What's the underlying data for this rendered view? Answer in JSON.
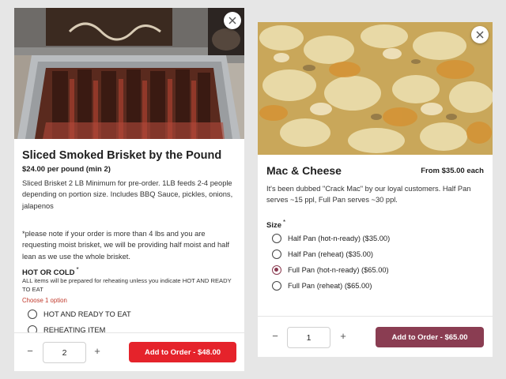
{
  "colors": {
    "add_red": "#e5232b",
    "add_maroon": "#8a3d52",
    "choose_red": "#c0392b"
  },
  "brisket": {
    "title": "Sliced Smoked Brisket by the Pound",
    "price": "$24.00 per pound  (min 2)",
    "description": "Sliced Brisket 2 LB Minimum for pre-order. 1LB feeds 2-4 people depending on portion size. Includes BBQ Sauce, pickles, onions, jalapenos",
    "note": "*please note if your order is more than 4 lbs and you are requesting moist brisket, we will be providing half moist and half lean as we use the whole brisket.",
    "option_group": {
      "title": "HOT OR COLD",
      "required_mark": "*",
      "subtitle": "ALL items will be prepared for reheating unless you indicate HOT AND READY TO EAT",
      "choose": "Choose 1 option",
      "options": [
        {
          "label": "HOT AND READY TO EAT",
          "selected": false
        },
        {
          "label": "REHEATING ITEM",
          "selected": false
        }
      ]
    },
    "footer": {
      "minus": "−",
      "qty": "2",
      "plus": "+",
      "add_label": "Add to Order - $48.00"
    }
  },
  "mac": {
    "title": "Mac & Cheese",
    "from_price": "From $35.00 each",
    "description": "It's been dubbed \"Crack Mac\" by our loyal customers. Half Pan serves ~15 ppl, Full Pan serves ~30 ppl.",
    "size_group": {
      "title": "Size",
      "required_mark": "*",
      "options": [
        {
          "label": "Half Pan (hot-n-ready) ($35.00)",
          "selected": false
        },
        {
          "label": "Half Pan (reheat) ($35.00)",
          "selected": false
        },
        {
          "label": "Full Pan (hot-n-ready) ($65.00)",
          "selected": true
        },
        {
          "label": "Full Pan (reheat) ($65.00)",
          "selected": false
        }
      ]
    },
    "footer": {
      "minus": "−",
      "qty": "1",
      "plus": "+",
      "add_label": "Add to Order - $65.00"
    }
  }
}
